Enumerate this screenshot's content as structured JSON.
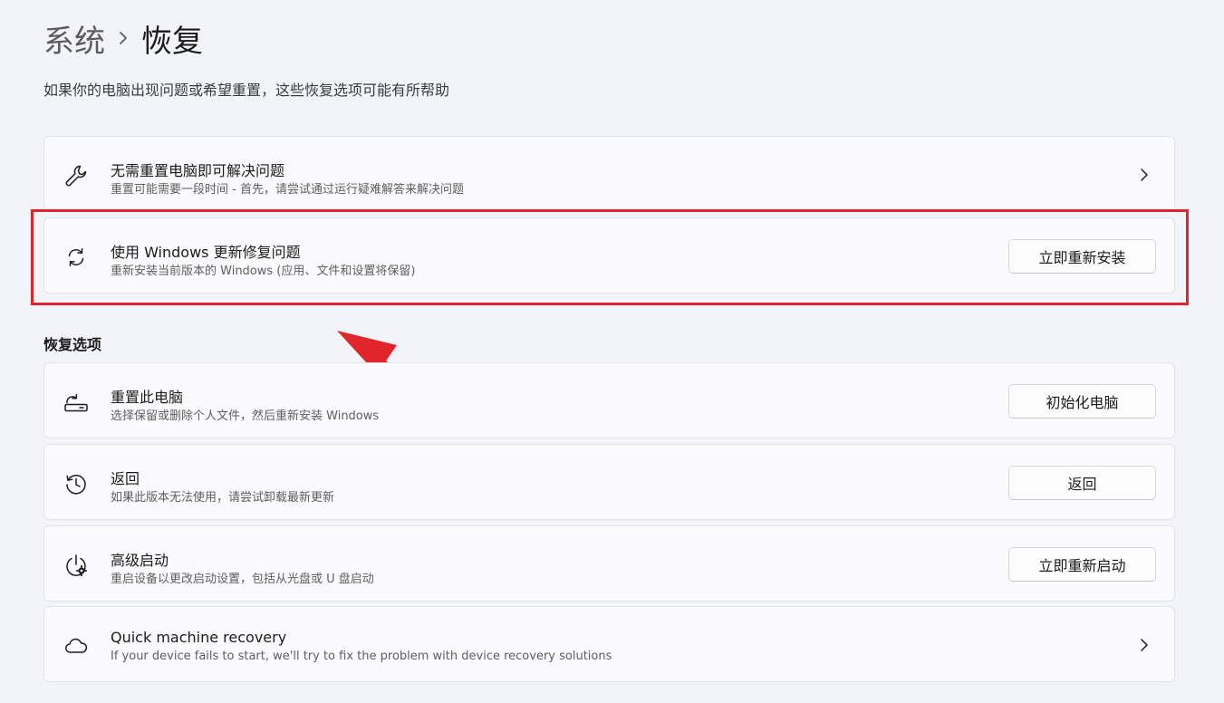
{
  "breadcrumb": {
    "parent": "系统",
    "current": "恢复"
  },
  "subtitle": "如果你的电脑出现问题或希望重置，这些恢复选项可能有所帮助",
  "top_cards": [
    {
      "icon": "wrench-icon",
      "title": "无需重置电脑即可解决问题",
      "description": "重置可能需要一段时间 - 首先，请尝试通过运行疑难解答来解决问题",
      "control": "chevron"
    },
    {
      "icon": "refresh-icon",
      "title": "使用 Windows 更新修复问题",
      "description": "重新安装当前版本的 Windows (应用、文件和设置将保留)",
      "control": "button",
      "button_label": "立即重新安装"
    }
  ],
  "section_header": "恢复选项",
  "recovery_options": [
    {
      "icon": "reset-pc-icon",
      "title": "重置此电脑",
      "description": "选择保留或删除个人文件，然后重新安装 Windows",
      "button_label": "初始化电脑"
    },
    {
      "icon": "history-icon",
      "title": "返回",
      "description": "如果此版本无法使用，请尝试卸载最新更新",
      "button_label": "返回"
    },
    {
      "icon": "advanced-startup-icon",
      "title": "高级启动",
      "description": "重启设备以更改启动设置，包括从光盘或 U 盘启动",
      "button_label": "立即重新启动"
    },
    {
      "icon": "cloud-icon",
      "title": "Quick machine recovery",
      "description": "If your device fails to start, we'll try to fix the problem with device recovery solutions",
      "control": "chevron"
    }
  ],
  "colors": {
    "background": "#f3f4f9",
    "card": "#fbfbfd",
    "annotation_red": "#e0262b"
  }
}
